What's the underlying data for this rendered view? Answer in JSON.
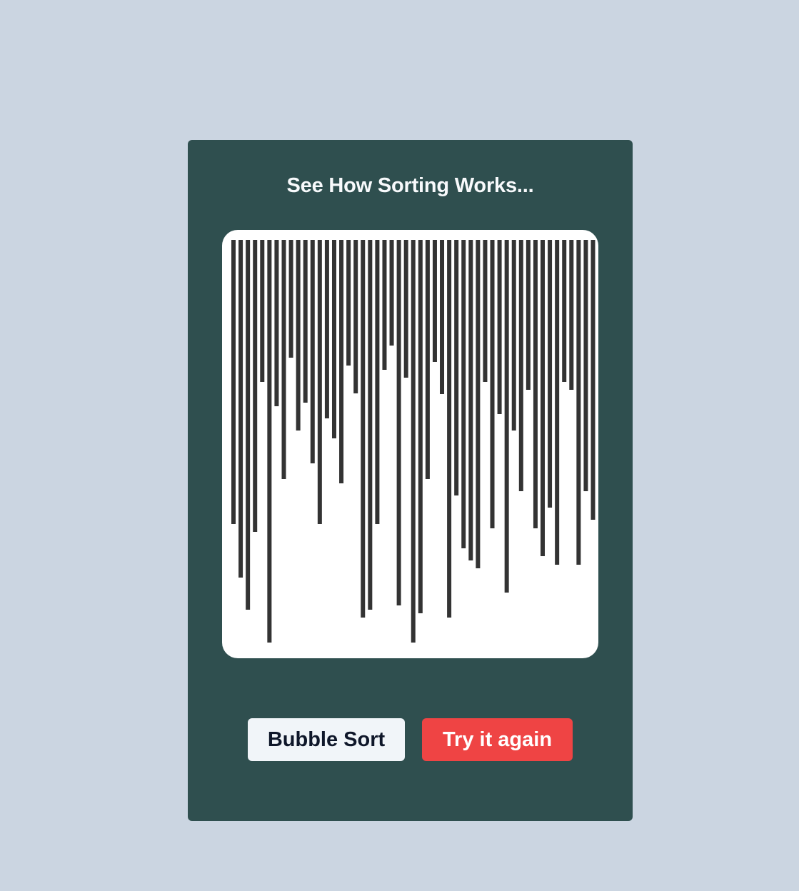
{
  "heading": "See How Sorting Works...",
  "buttons": {
    "sort_label": "Bubble Sort",
    "retry_label": "Try it again"
  },
  "colors": {
    "page_background": "#cbd5e1",
    "card_background": "#2f4f4f",
    "bar_color": "#333333",
    "sort_button_bg": "#f1f5f9",
    "retry_button_bg": "#ef4444"
  },
  "chart_data": {
    "type": "bar",
    "orientation": "downward",
    "values": [
      398,
      473,
      518,
      409,
      199,
      564,
      233,
      335,
      165,
      267,
      228,
      313,
      398,
      250,
      278,
      341,
      176,
      215,
      529,
      518,
      398,
      182,
      148,
      512,
      193,
      564,
      523,
      335,
      171,
      216,
      529,
      358,
      432,
      449,
      460,
      199,
      404,
      244,
      494,
      267,
      352,
      210,
      404,
      443,
      375,
      455,
      199,
      210,
      455,
      352,
      392
    ],
    "ylim": [
      0,
      600
    ]
  }
}
